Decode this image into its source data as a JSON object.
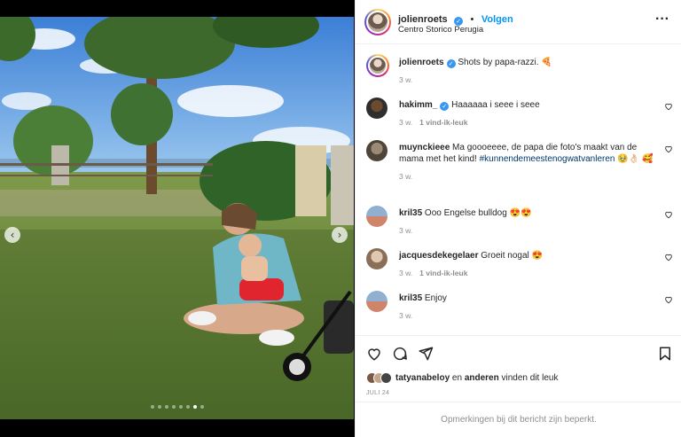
{
  "header": {
    "username": "jolienroets",
    "separator": "•",
    "follow_label": "Volgen",
    "location": "Centro Storico Perugia",
    "more_icon": "more-horizontal-icon"
  },
  "caption": {
    "username": "jolienroets",
    "text": "Shots by papa-razzi. 🍕",
    "time": "3 w."
  },
  "comments": [
    {
      "username": "hakimm_",
      "verified": true,
      "text": "Haaaaaa i seee i seee",
      "time": "3 w.",
      "likes": "1 vind-ik-leuk"
    },
    {
      "username": "muynckieee",
      "verified": false,
      "text": "Ma goooeeee, de papa die foto's maakt van de mama met het kind!",
      "hashtag": "#kunnendemeestenogwatvanleren",
      "text_after": " 🥹👌🏻 🥰",
      "time": "3 w.",
      "likes": ""
    },
    {
      "username": "kril35",
      "verified": false,
      "text": "Ooo Engelse bulldog 😍😍",
      "time": "3 w.",
      "likes": ""
    },
    {
      "username": "jacquesdekegelaer",
      "verified": false,
      "text": "Groeit nogal 😍",
      "time": "3 w.",
      "likes": "1 vind-ik-leuk"
    },
    {
      "username": "kril35",
      "verified": false,
      "text": "Enjoy",
      "time": "3 w.",
      "likes": ""
    }
  ],
  "actions": {
    "like_icon": "heart-icon",
    "comment_icon": "comment-icon",
    "share_icon": "share-icon",
    "save_icon": "bookmark-icon"
  },
  "likes_summary": {
    "user": "tatyanabeloy",
    "connector": " en ",
    "others": "anderen",
    "suffix": " vinden dit leuk"
  },
  "post_date": "JULI 24",
  "footer_text": "Opmerkingen bij dit bericht zijn beperkt.",
  "carousel": {
    "prev": "‹",
    "next": "›",
    "slides": 8,
    "active": 7
  },
  "colors": {
    "link": "#0095f6",
    "verified": "#3897f0",
    "muted": "#8e8e8e",
    "hashtag": "#00376b"
  }
}
